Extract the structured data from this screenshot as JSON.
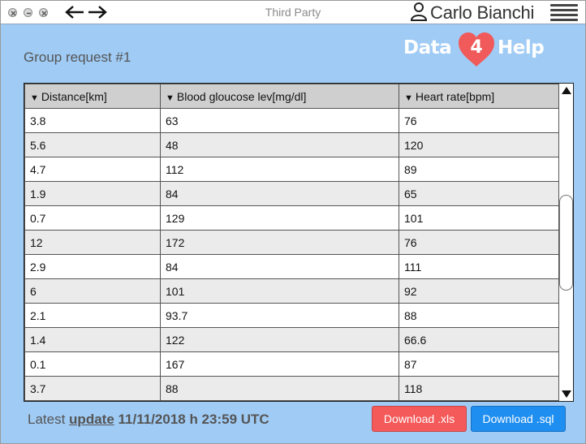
{
  "window": {
    "title": "Third Party"
  },
  "user": {
    "name": "Carlo Bianchi"
  },
  "logo": {
    "left": "Data",
    "number": "4",
    "right": "Help"
  },
  "page": {
    "title": "Group request #1"
  },
  "table": {
    "columns": [
      "Distance[km]",
      "Blood gloucose lev[mg/dl]",
      "Heart rate[bpm]"
    ],
    "rows": [
      [
        "3.8",
        "63",
        "76"
      ],
      [
        "5.6",
        "48",
        "120"
      ],
      [
        "4.7",
        "112",
        "89"
      ],
      [
        "1.9",
        "84",
        "65"
      ],
      [
        "0.7",
        "129",
        "101"
      ],
      [
        "12",
        "172",
        "76"
      ],
      [
        "2.9",
        "84",
        "111"
      ],
      [
        "6",
        "101",
        "92"
      ],
      [
        "2.1",
        "93.7",
        "88"
      ],
      [
        "1.4",
        "122",
        "66.6"
      ],
      [
        "0.1",
        "167",
        "87"
      ],
      [
        "3.7",
        "88",
        "118"
      ]
    ]
  },
  "footer": {
    "prefix": "Latest",
    "link": "update",
    "timestamp": "11/11/2018 h 23:59 UTC"
  },
  "buttons": {
    "xls": "Download .xls",
    "sql": "Download .sql"
  },
  "colors": {
    "background": "#9fcbf5",
    "xls_button": "#f55a5a",
    "sql_button": "#1e8ef0",
    "heart": "#f05a5a"
  }
}
